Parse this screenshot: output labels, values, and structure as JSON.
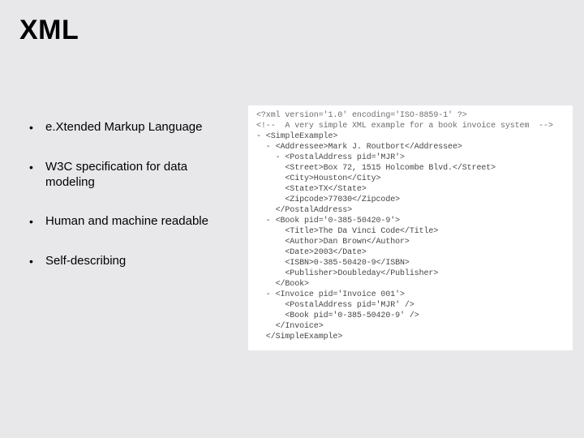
{
  "title": "XML",
  "bullets": [
    "e.Xtended Markup Language",
    "W3C specification for data modeling",
    "Human and machine readable",
    "Self-describing"
  ],
  "code": {
    "lines": [
      "<?xml version='1.0' encoding='ISO-8859-1' ?>",
      "<!--  A very simple XML example for a book invoice system  -->",
      "- <SimpleExample>",
      "  - <Addressee>Mark J. Routbort</Addressee>",
      "    - <PostalAddress pid='MJR'>",
      "      <Street>Box 72, 1515 Holcombe Blvd.</Street>",
      "      <City>Houston</City>",
      "      <State>TX</State>",
      "      <Zipcode>77030</Zipcode>",
      "    </PostalAddress>",
      "  - <Book pid='0-385-50420-9'>",
      "      <Title>The Da Vinci Code</Title>",
      "      <Author>Dan Brown</Author>",
      "      <Date>2003</Date>",
      "      <ISBN>0-385-50420-9</ISBN>",
      "      <Publisher>Doubleday</Publisher>",
      "    </Book>",
      "  - <Invoice pid='Invoice 001'>",
      "      <PostalAddress pid='MJR' />",
      "      <Book pid='0-385-50420-9' />",
      "    </Invoice>",
      "  </SimpleExample>"
    ]
  }
}
